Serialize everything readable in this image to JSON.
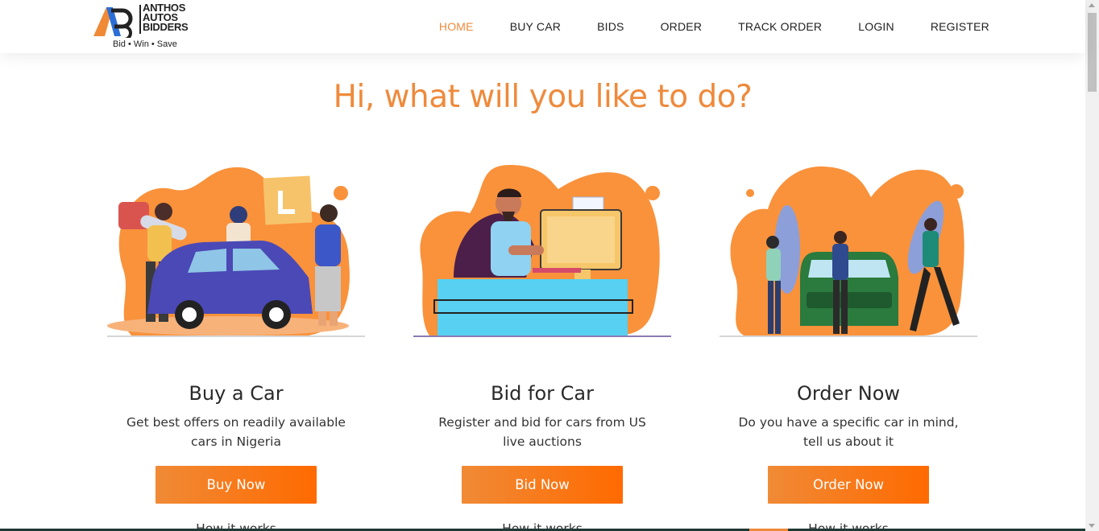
{
  "brand": {
    "line1": "ANTHOS",
    "line2": "AUTOS",
    "line3": "BIDDERS",
    "tagline": "Bid • Win • Save",
    "accent": "#ee8a3c"
  },
  "nav": {
    "items": [
      {
        "label": "HOME",
        "active": true
      },
      {
        "label": "BUY CAR"
      },
      {
        "label": "BIDS"
      },
      {
        "label": "ORDER"
      },
      {
        "label": "TRACK ORDER"
      },
      {
        "label": "LOGIN"
      },
      {
        "label": "REGISTER"
      }
    ]
  },
  "headline": "Hi, what will you like to do?",
  "cards": [
    {
      "illustration": "people-with-car-and-learner-sign",
      "title": "Buy a Car",
      "description": "Get best offers on readily available cars in Nigeria",
      "button": "Buy Now",
      "link": "How it works"
    },
    {
      "illustration": "man-at-computer-bidding",
      "title": "Bid for Car",
      "description": "Register and bid for cars from US live auctions",
      "button": "Bid Now",
      "link": "How it works"
    },
    {
      "illustration": "people-around-green-car",
      "title": "Order Now",
      "description": "Do you have a specific car in mind, tell us about it",
      "button": "Order Now",
      "link": "How it works"
    }
  ]
}
